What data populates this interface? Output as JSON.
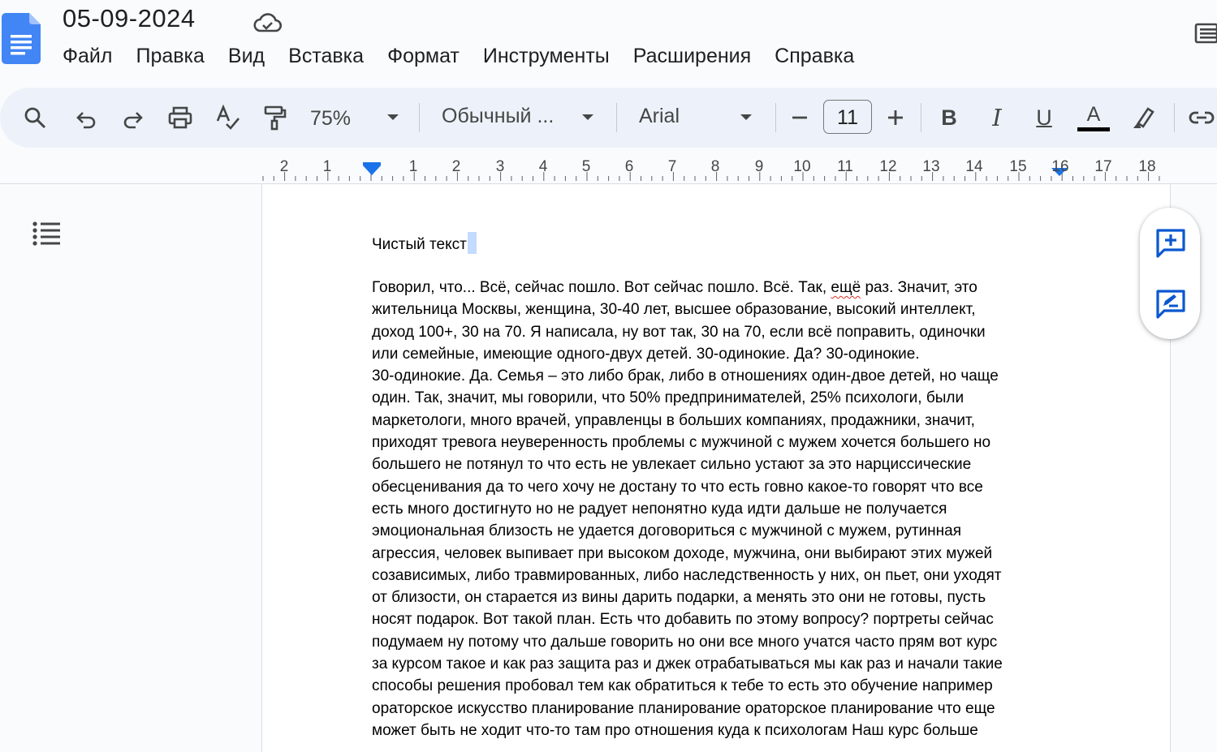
{
  "header": {
    "title": "05-09-2024",
    "icons": {
      "logo": "google-docs-logo",
      "cloud": "cloud-done-icon",
      "panel": "side-panel-icon"
    }
  },
  "menu": [
    "Файл",
    "Правка",
    "Вид",
    "Вставка",
    "Формат",
    "Инструменты",
    "Расширения",
    "Справка"
  ],
  "toolbar": {
    "zoom": "75%",
    "style": "Обычный ...",
    "font": "Arial",
    "font_size": "11",
    "bold_label": "B",
    "italic_label": "I",
    "underline_label": "U",
    "text_color_label": "A",
    "text_color": "#000000",
    "accent": "#1a73e8"
  },
  "ruler": {
    "numbers": [
      "2",
      "1",
      "1",
      "2",
      "3",
      "4",
      "5",
      "6",
      "7",
      "8",
      "9",
      "10",
      "11",
      "12",
      "13",
      "14",
      "15",
      "16",
      "17",
      "18"
    ]
  },
  "document": {
    "heading": "Чистый текст",
    "spell_error_word": "ещё",
    "lines": [
      "Говорил, что... Всё, сейчас пошло. Вот сейчас пошло. Всё. Так, ",
      "жительница Москвы, женщина, 30-40 лет, высшее образование, высокий интеллект,",
      "доход 100+, 30 на 70. Я написала, ну вот так, 30 на 70, если всё поправить, одиночки",
      "или семейные, имеющие одного-двух детей. 30-одинокие. Да? 30-одинокие.",
      "30-одинокие. Да. Семья – это либо брак, либо в отношениях один-двое детей, но чаще",
      "один. Так, значит, мы говорили, что 50% предпринимателей, 25% психологи, были",
      "маркетологи, много врачей, управленцы в больших компаниях, продажники, значит,",
      "приходят тревога неуверенность проблемы с мужчиной с мужем хочется большего но",
      "большего не потянул то что есть не увлекает сильно устают за это нарциссические",
      "обесценивания да то чего хочу не достану то что есть говно какое-то говорят что все",
      "есть много достигнуто но не радует непонятно куда идти дальше не получается",
      "эмоциональная близость не удается договориться с мужчиной с мужем, рутинная",
      "агрессия, человек выпивает при высоком доходе, мужчина, они выбирают этих мужей",
      "созависимых, либо травмированных, либо наследственность у них, он пьет, они уходят",
      "от близости, он старается из вины дарить подарки, а менять это они не готовы, пусть",
      "носят подарок. Вот такой план. Есть что добавить по этому вопросу? портреты сейчас",
      "подумаем ну потому что дальше говорить но они все много учатся часто прям вот курс",
      "за курсом такое и как раз защита раз и джек отрабатываться мы как раз и начали такие",
      "способы решения пробовал тем как обратиться к тебе то есть это обучение например",
      "ораторское искусство планирование планирование ораторское планирование что еще",
      "может быть не ходит что-то там про отношения куда к психологам Наш курс больше"
    ],
    "line1_tail": " раз. Значит, это"
  }
}
